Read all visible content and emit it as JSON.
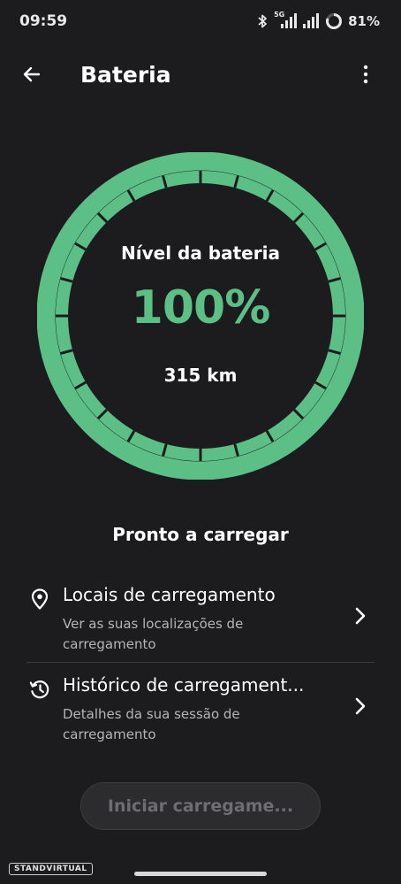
{
  "status_bar": {
    "time": "09:59",
    "network_label": "5G",
    "battery_percent": "81%",
    "icons": [
      "bluetooth-icon",
      "signal-5g-icon",
      "signal-icon",
      "battery-ring-icon"
    ]
  },
  "header": {
    "title": "Bateria",
    "back_icon": "arrow-left-icon",
    "menu_icon": "more-vertical-icon"
  },
  "gauge": {
    "title": "Nível da bateria",
    "percent_text": "100%",
    "level": 1.0,
    "range": "315 km",
    "ring_color": "#5bbf86",
    "track_color": "#3f7a58"
  },
  "ready_text": "Pronto a carregar",
  "list": [
    {
      "icon": "location-pin-icon",
      "title": "Locais de carregamento",
      "subtitle": "Ver as suas localizações de carregamento"
    },
    {
      "icon": "history-icon",
      "title": "Histórico de carregament...",
      "subtitle": "Detalhes da sua sessão de carregamento"
    }
  ],
  "start_button": {
    "label": "Iniciar carregame...",
    "disabled": true
  },
  "watermark": "STANDVIRTUAL"
}
